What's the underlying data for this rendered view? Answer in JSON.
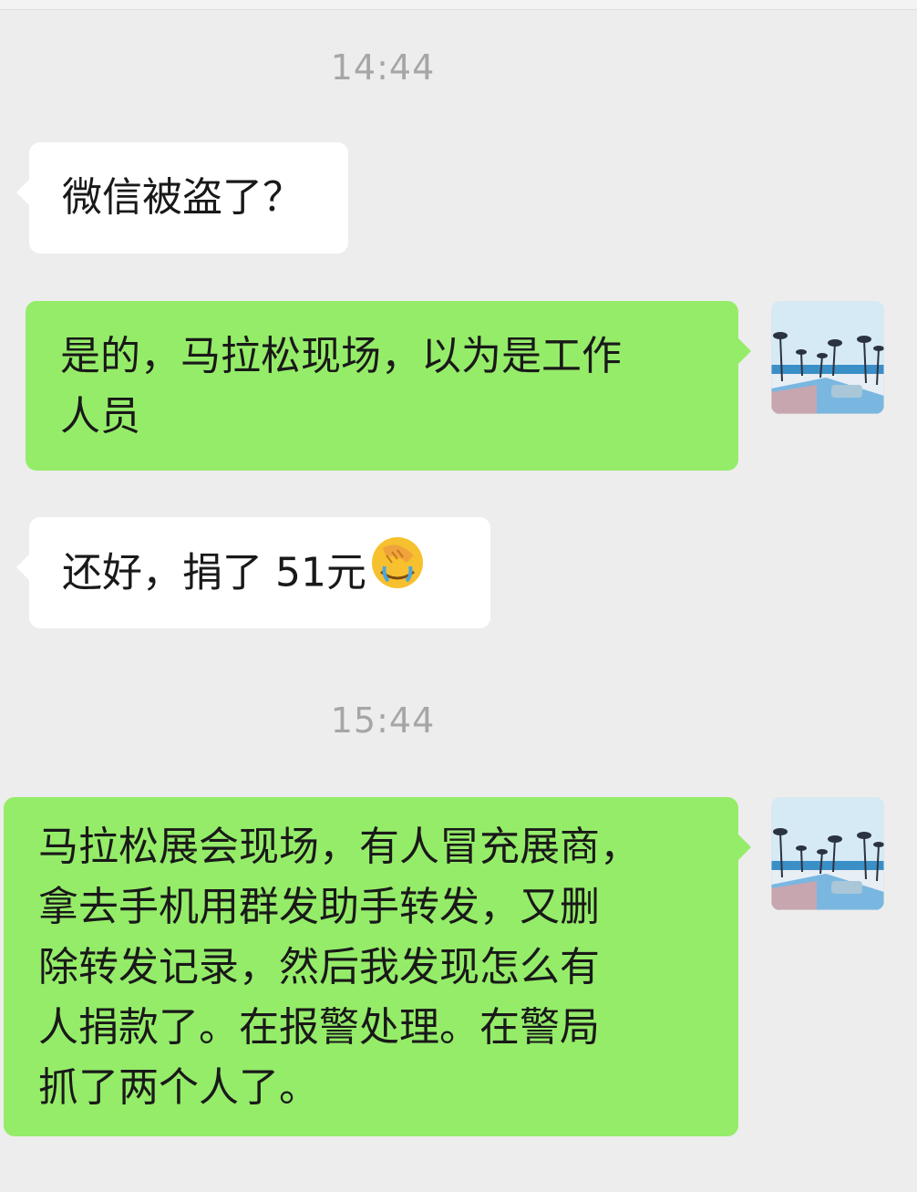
{
  "messages": [
    {
      "type": "time",
      "text": "14:44"
    },
    {
      "type": "in",
      "text": "微信被盗了？"
    },
    {
      "type": "out",
      "lines": [
        "是的，马拉松现场，以为是工作",
        "人员"
      ]
    },
    {
      "type": "in",
      "text": "还好，捐了 51元",
      "emoji": "facepalm-crying-emoji"
    },
    {
      "type": "time",
      "text": "15:44"
    },
    {
      "type": "out",
      "lines": [
        "马拉松展会现场，有人冒充展商，",
        "拿去手机用群发助手转发，又删",
        "除转发记录，然后我发现怎么有",
        "人捐款了。在报警处理。在警局",
        "抓了两个人了。"
      ]
    }
  ],
  "colors": {
    "background": "#ededed",
    "incoming_bubble": "#ffffff",
    "outgoing_bubble": "#95ec69",
    "timestamp": "#a6a6a6"
  },
  "avatar": {
    "icon": "beach-palm-trees-avatar"
  }
}
